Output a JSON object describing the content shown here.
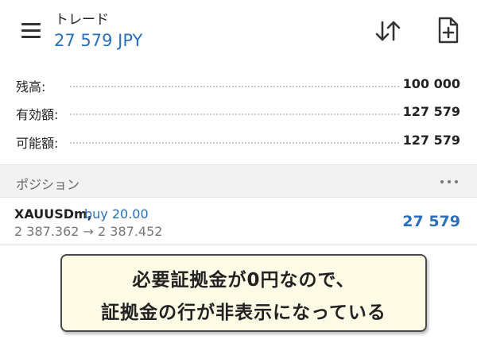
{
  "header": {
    "title": "トレード",
    "profit": "27 579 JPY",
    "menu_icon": "hamburger-menu-icon",
    "sort_icon": "sort-arrows-icon",
    "new_order_icon": "new-order-document-icon"
  },
  "summary": [
    {
      "label": "残高:",
      "value": "100 000"
    },
    {
      "label": "有効額:",
      "value": "127 579"
    },
    {
      "label": "可能額:",
      "value": "127 579"
    }
  ],
  "positions_section": {
    "title": "ポジション",
    "more_icon": "more-horizontal-icon"
  },
  "positions": [
    {
      "symbol": "XAUUSDm,",
      "side": "buy 20.00",
      "prices": "2 387.362 → 2 387.452",
      "profit": "27 579"
    }
  ],
  "callout": {
    "line1": "必要証拠金が0円なので、",
    "line2": "証拠金の行が非表示になっている"
  },
  "colors": {
    "accent": "#2a6fb8",
    "callout_bg": "#fdfbe6"
  }
}
